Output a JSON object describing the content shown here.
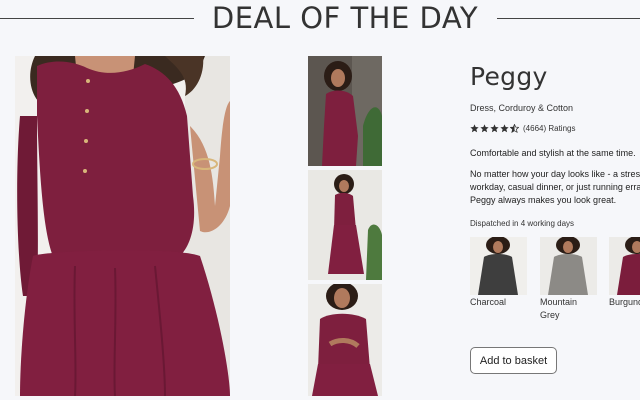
{
  "header": {
    "title": "DEAL OF THE DAY"
  },
  "product": {
    "name": "Peggy",
    "subtitle": "Dress, Corduroy & Cotton",
    "rating": 4.5,
    "rating_count_label": "(4664) Ratings",
    "tagline": "Comfortable and stylish at the same time.",
    "description_lines": [
      "No matter how your day looks like - a stress",
      "workday, casual dinner, or just running erran",
      "Peggy always makes you look great."
    ],
    "dispatch": "Dispatched in 4 working days",
    "colors": [
      {
        "label": "Charcoal",
        "swatch": "#3e3e3e"
      },
      {
        "label": "Mountain Grey",
        "swatch": "#8c8a86"
      },
      {
        "label": "Burgund",
        "swatch": "#7b1d3c"
      }
    ],
    "add_button": "Add to basket",
    "accent_color": "#7e1f3e",
    "star_color": "#333333"
  }
}
